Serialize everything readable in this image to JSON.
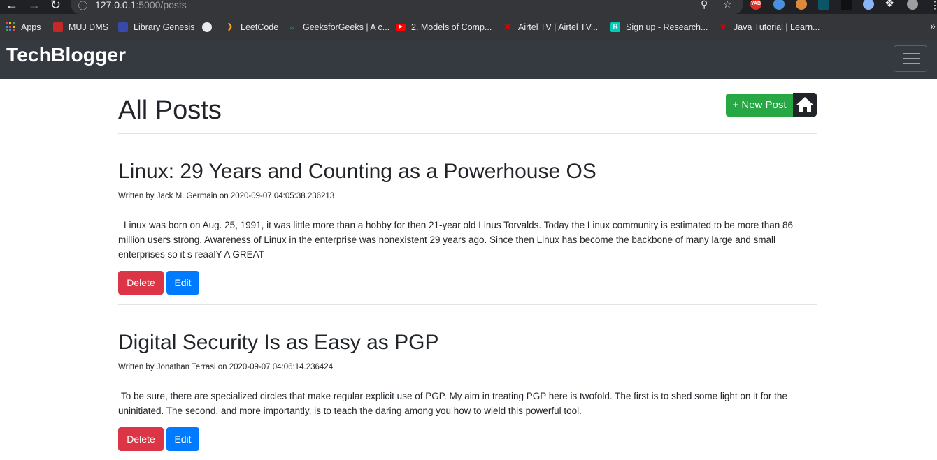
{
  "browser": {
    "url_host": "127.0.0.1",
    "url_path": ":5000/posts",
    "extension_badge": "YAB",
    "bookmarks": [
      {
        "label": "Apps",
        "icon": "apps-grid-icon",
        "color": "#e8453c"
      },
      {
        "label": "MUJ DMS",
        "icon": "muj-icon",
        "color": "#c62828"
      },
      {
        "label": "Library Genesis",
        "icon": "library-icon",
        "color": "#3949ab"
      },
      {
        "label": "",
        "icon": "globe-icon",
        "color": "#e8eaed"
      },
      {
        "label": "LeetCode",
        "icon": "leetcode-icon",
        "color": "#f89f1b"
      },
      {
        "label": "GeeksforGeeks | A c...",
        "icon": "gfg-icon",
        "color": "#2f8d46"
      },
      {
        "label": "2. Models of Comp...",
        "icon": "youtube-icon",
        "color": "#ff0000"
      },
      {
        "label": "Airtel TV | Airtel TV...",
        "icon": "airtel-icon",
        "color": "#e40000"
      },
      {
        "label": "Sign up - Research...",
        "icon": "researchgate-icon",
        "color": "#00ccbb"
      },
      {
        "label": "Java Tutorial | Learn...",
        "icon": "java-tutorial-icon",
        "color": "#d50000"
      }
    ]
  },
  "app": {
    "brand": "TechBlogger",
    "page_title": "All Posts",
    "new_post_label": "+ New Post",
    "posts": [
      {
        "title": "Linux: 29 Years and Counting as a Powerhouse OS",
        "byline": "Written by Jack M. Germain on 2020-09-07 04:05:38.236213",
        "body": "Linux was born on Aug. 25, 1991, it was little more than a hobby for then 21-year old Linus Torvalds. Today the Linux community is estimated to be more than 86 million users strong. Awareness of Linux in the enterprise was nonexistent 29 years ago. Since then Linux has become the backbone of many large and small enterprises so it s reaalY A GREAT",
        "delete_label": "Delete",
        "edit_label": "Edit"
      },
      {
        "title": "Digital Security Is as Easy as PGP",
        "byline": "Written by Jonathan Terrasi on 2020-09-07 04:06:14.236424",
        "body": "To be sure, there are specialized circles that make regular explicit use of PGP. My aim in treating PGP here is twofold. The first is to shed some light on it for the uninitiated. The second, and more importantly, is to teach the daring among you how to wield this powerful tool.",
        "delete_label": "Delete",
        "edit_label": "Edit"
      }
    ]
  },
  "colors": {
    "navbar": "#343a40",
    "success": "#28a745",
    "danger": "#dc3545",
    "primary": "#007bff"
  }
}
